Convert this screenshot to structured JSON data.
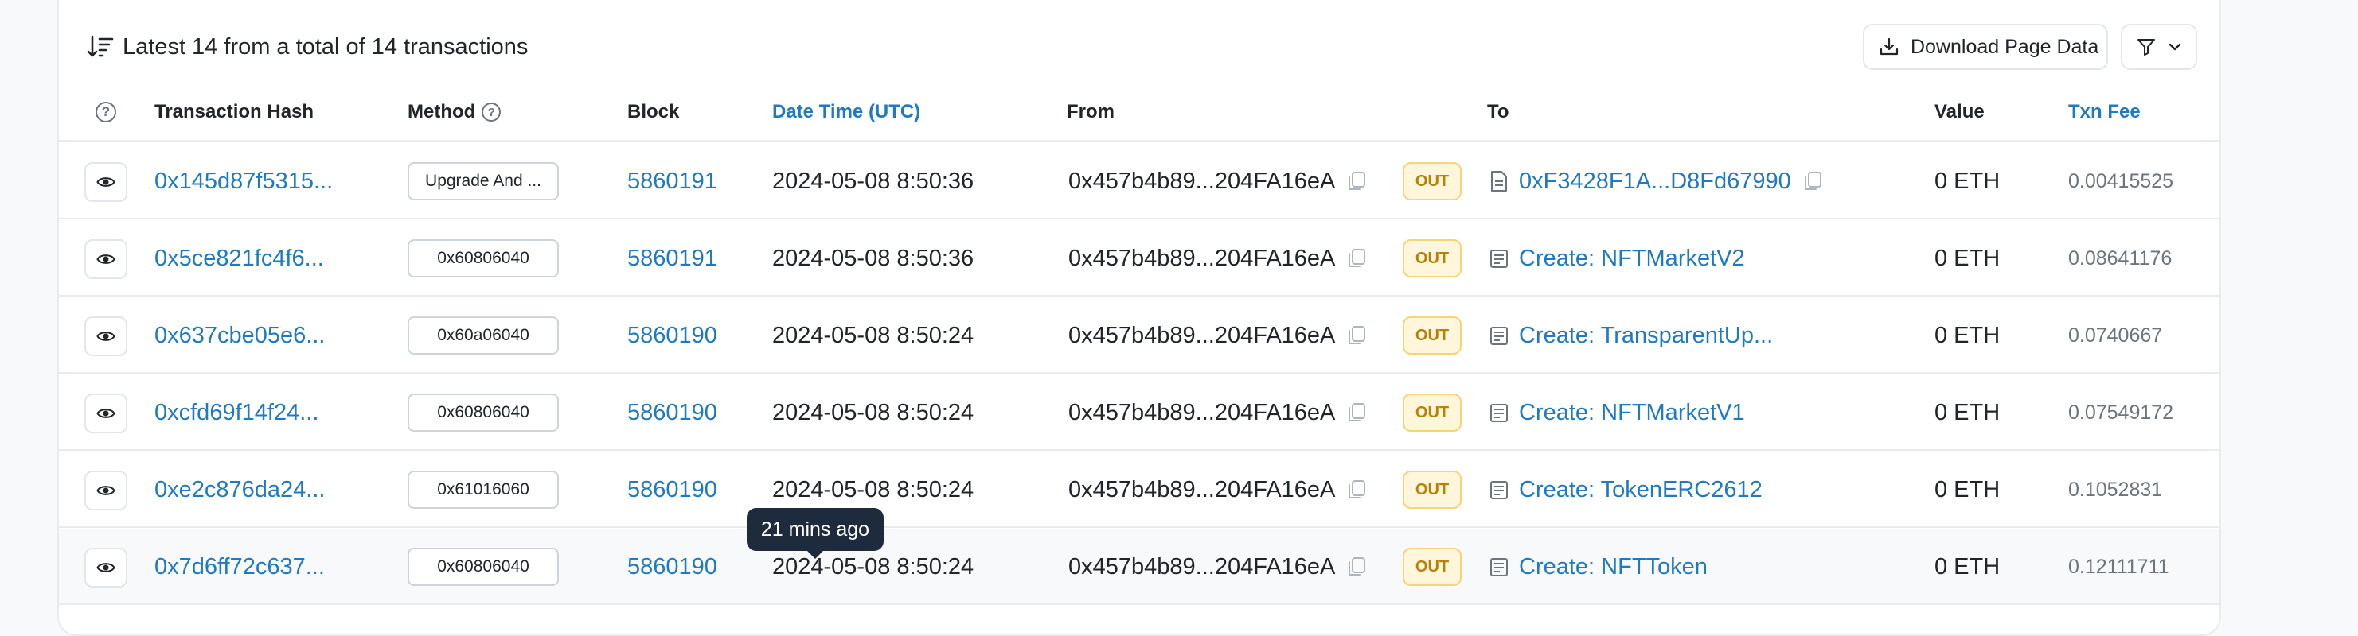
{
  "header": {
    "summary": "Latest 14 from a total of 14 transactions",
    "download_label": "Download Page Data"
  },
  "columns": {
    "hash": "Transaction Hash",
    "method": "Method",
    "block": "Block",
    "datetime": "Date Time (UTC)",
    "from": "From",
    "to": "To",
    "value": "Value",
    "fee": "Txn Fee"
  },
  "rows": [
    {
      "hash": "0x145d87f5315...",
      "method": "Upgrade And ...",
      "block": "5860191",
      "datetime": "2024-05-08 8:50:36",
      "from": "0x457b4b89...204FA16eA",
      "direction": "OUT",
      "to": "0xF3428F1A...D8Fd67990",
      "to_type": "address",
      "value": "0 ETH",
      "fee": "0.00415525"
    },
    {
      "hash": "0x5ce821fc4f6...",
      "method": "0x60806040",
      "block": "5860191",
      "datetime": "2024-05-08 8:50:36",
      "from": "0x457b4b89...204FA16eA",
      "direction": "OUT",
      "to": "Create: NFTMarketV2",
      "to_type": "contract",
      "value": "0 ETH",
      "fee": "0.08641176"
    },
    {
      "hash": "0x637cbe05e6...",
      "method": "0x60a06040",
      "block": "5860190",
      "datetime": "2024-05-08 8:50:24",
      "from": "0x457b4b89...204FA16eA",
      "direction": "OUT",
      "to": "Create: TransparentUp...",
      "to_type": "contract",
      "value": "0 ETH",
      "fee": "0.0740667"
    },
    {
      "hash": "0xcfd69f14f24...",
      "method": "0x60806040",
      "block": "5860190",
      "datetime": "2024-05-08 8:50:24",
      "from": "0x457b4b89...204FA16eA",
      "direction": "OUT",
      "to": "Create: NFTMarketV1",
      "to_type": "contract",
      "value": "0 ETH",
      "fee": "0.07549172"
    },
    {
      "hash": "0xe2c876da24...",
      "method": "0x61016060",
      "block": "5860190",
      "datetime": "2024-05-08 8:50:24",
      "from": "0x457b4b89...204FA16eA",
      "direction": "OUT",
      "to": "Create: TokenERC2612",
      "to_type": "contract",
      "value": "0 ETH",
      "fee": "0.1052831"
    },
    {
      "hash": "0x7d6ff72c637...",
      "method": "0x60806040",
      "block": "5860190",
      "datetime": "2024-05-08 8:50:24",
      "from": "0x457b4b89...204FA16eA",
      "direction": "OUT",
      "to": "Create: NFTToken",
      "to_type": "contract",
      "value": "0 ETH",
      "fee": "0.12111711"
    }
  ],
  "tooltip": "21 mins ago",
  "colors": {
    "link": "#1f7ac2",
    "out_badge": "#b78105",
    "tooltip_bg": "#1e2b3c"
  }
}
